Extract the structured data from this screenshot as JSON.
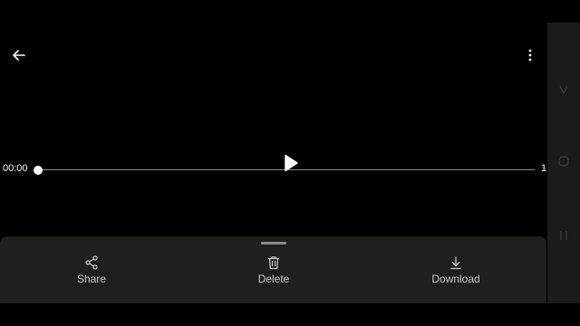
{
  "top_bar": {
    "back_icon": "arrow-left-icon",
    "more_icon": "more-vertical-icon"
  },
  "player": {
    "current_time": "00:00",
    "total_time": "1",
    "progress": 0,
    "play_icon": "play-icon"
  },
  "bottom_sheet": {
    "actions": [
      {
        "label": "Share",
        "icon": "share-icon"
      },
      {
        "label": "Delete",
        "icon": "trash-icon"
      },
      {
        "label": "Download",
        "icon": "download-icon"
      }
    ]
  },
  "system_nav": {
    "buttons": [
      "back-icon",
      "home-icon",
      "recents-icon"
    ]
  },
  "colors": {
    "background": "#000000",
    "sheet": "#1f201e",
    "nav_bar": "#1b1b1b",
    "text": "#ffffff",
    "label": "#c9c9c9"
  }
}
